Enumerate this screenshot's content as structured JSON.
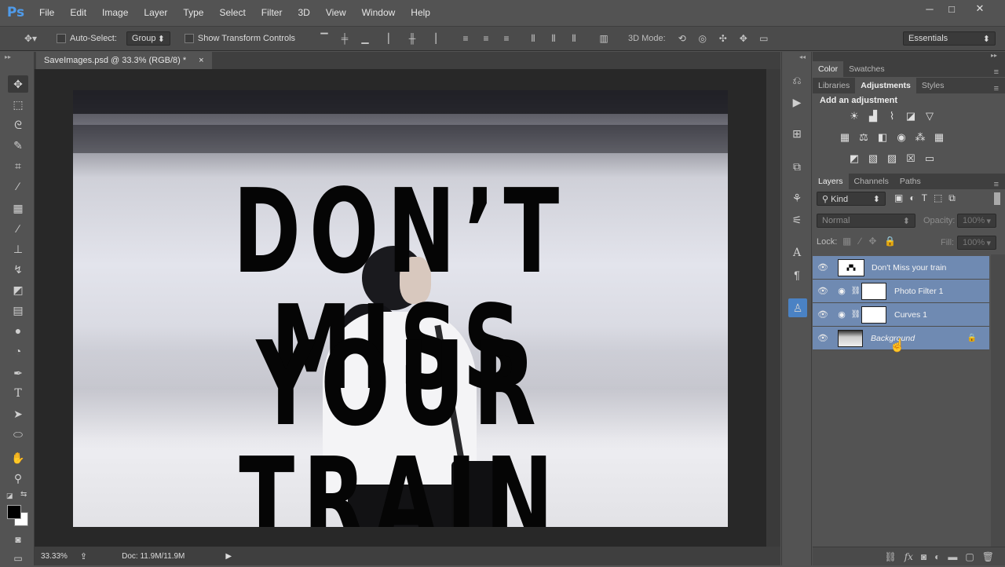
{
  "app": {
    "logo": "Ps"
  },
  "menu": [
    "File",
    "Edit",
    "Image",
    "Layer",
    "Type",
    "Select",
    "Filter",
    "3D",
    "View",
    "Window",
    "Help"
  ],
  "window_controls": {
    "minimize": "─",
    "maximize": "□",
    "close": "✕"
  },
  "options": {
    "auto_select_label": "Auto-Select:",
    "auto_select_value": "Group",
    "transform_label": "Show Transform Controls",
    "mode_3d_label": "3D Mode:",
    "workspace": "Essentials"
  },
  "document": {
    "tab_title": "SaveImages.psd @ 33.3% (RGB/8) *",
    "close": "×"
  },
  "poster": {
    "line1": "DON’T MISS",
    "line2": "YOUR TRAIN"
  },
  "status": {
    "zoom": "33.33%",
    "doc_info": "Doc: 11.9M/11.9M"
  },
  "panels": {
    "color_tabs": [
      "Color",
      "Swatches"
    ],
    "adj_tabs": [
      "Libraries",
      "Adjustments",
      "Styles"
    ],
    "adj_title": "Add an adjustment",
    "layers_tabs": [
      "Layers",
      "Channels",
      "Paths"
    ],
    "filter_kind": "Kind",
    "blend_mode": "Normal",
    "opacity_label": "Opacity:",
    "opacity_value": "100%",
    "lock_label": "Lock:",
    "fill_label": "Fill:",
    "fill_value": "100%"
  },
  "layers": [
    {
      "name": "Don't Miss your train"
    },
    {
      "name": "Photo Filter 1"
    },
    {
      "name": "Curves 1"
    },
    {
      "name": "Background"
    }
  ],
  "colors": {
    "selection": "#6f8ab2",
    "ps_blue": "#4f9bea"
  }
}
